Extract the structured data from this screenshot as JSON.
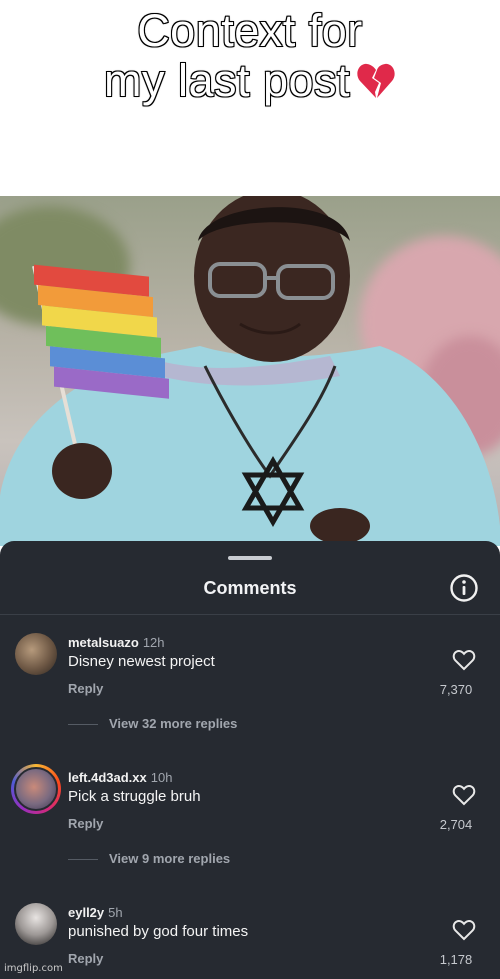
{
  "meme": {
    "caption_line1": "Context for",
    "caption_line2": "my last post",
    "caption_emoji_icon": "broken-heart-icon"
  },
  "sheet": {
    "title": "Comments",
    "info_icon": "info-icon"
  },
  "comments": [
    {
      "username": "metalsuazo",
      "time": "12h",
      "text": "Disney newest project",
      "reply_label": "Reply",
      "likes": "7,370",
      "more_replies": "View 32 more replies"
    },
    {
      "username": "left.4d3ad.xx",
      "time": "10h",
      "text": "Pick a struggle bruh",
      "reply_label": "Reply",
      "likes": "2,704",
      "more_replies": "View 9 more replies"
    },
    {
      "username": "eyll2y",
      "time": "5h",
      "text": "punished by god four times",
      "reply_label": "Reply",
      "likes": "1,178"
    }
  ],
  "watermark": "imgflip.com",
  "colors": {
    "sheet_bg": "#262a31",
    "text_primary": "#f4f4f4",
    "text_secondary": "#a1a6ae",
    "story_ring": "#d62976"
  }
}
